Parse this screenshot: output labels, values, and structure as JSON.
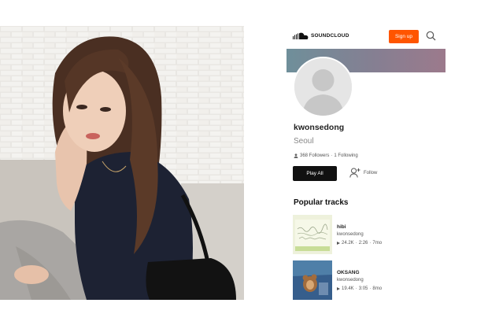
{
  "header": {
    "logo_text": "SOUNDCLOUD",
    "signup_label": "Sign up"
  },
  "profile": {
    "username": "kwonsedong",
    "city": "Seoul",
    "followers": "368 Followers",
    "following": "1 Following",
    "separator": "·"
  },
  "actions": {
    "play_all_label": "Play All",
    "follow_label": "Follow"
  },
  "popular": {
    "heading": "Popular tracks",
    "tracks": [
      {
        "title": "hibi",
        "artist": "kwonsedong",
        "plays": "24.2K",
        "duration": "2:26",
        "age": "7mo"
      },
      {
        "title": "OKSANG",
        "artist": "kwonsedong",
        "plays": "19.4K",
        "duration": "3:05",
        "age": "8mo"
      }
    ]
  },
  "colors": {
    "accent": "#ff5500",
    "button_dark": "#111111"
  },
  "icons": [
    "soundcloud-logo-icon",
    "search-icon",
    "user-icon",
    "add-user-icon",
    "play-icon"
  ]
}
